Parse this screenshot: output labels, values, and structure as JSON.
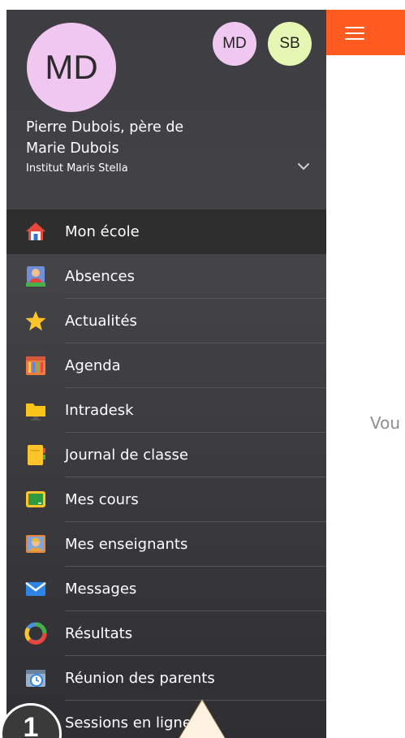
{
  "topbar": {
    "menu_icon": "hamburger-icon",
    "color": "#ff5a1f"
  },
  "main": {
    "partial_text": "Vou"
  },
  "drawer": {
    "avatar_initials": "MD",
    "accounts": [
      {
        "initials": "MD",
        "color": "#f0c7f1"
      },
      {
        "initials": "SB",
        "color": "#e6f7b4"
      }
    ],
    "user_line1": "Pierre Dubois, père de",
    "user_line2": "Marie Dubois",
    "school": "Institut Maris Stella",
    "expand_icon": "chevron-down-icon",
    "items": [
      {
        "label": "Mon école",
        "icon": "house-icon",
        "active": true
      },
      {
        "label": "Absences",
        "icon": "student-absence-icon"
      },
      {
        "label": "Actualités",
        "icon": "star-icon"
      },
      {
        "label": "Agenda",
        "icon": "calendar-icon"
      },
      {
        "label": "Intradesk",
        "icon": "folder-icon"
      },
      {
        "label": "Journal de classe",
        "icon": "notebook-icon"
      },
      {
        "label": "Mes cours",
        "icon": "chalkboard-icon"
      },
      {
        "label": "Mes enseignants",
        "icon": "teacher-icon"
      },
      {
        "label": "Messages",
        "icon": "envelope-icon"
      },
      {
        "label": "Résultats",
        "icon": "results-ring-icon"
      },
      {
        "label": "Réunion des parents",
        "icon": "meeting-clock-icon"
      },
      {
        "label": "Sessions en ligne",
        "icon": "online-session-icon"
      }
    ]
  },
  "tutorial": {
    "step": "1"
  }
}
